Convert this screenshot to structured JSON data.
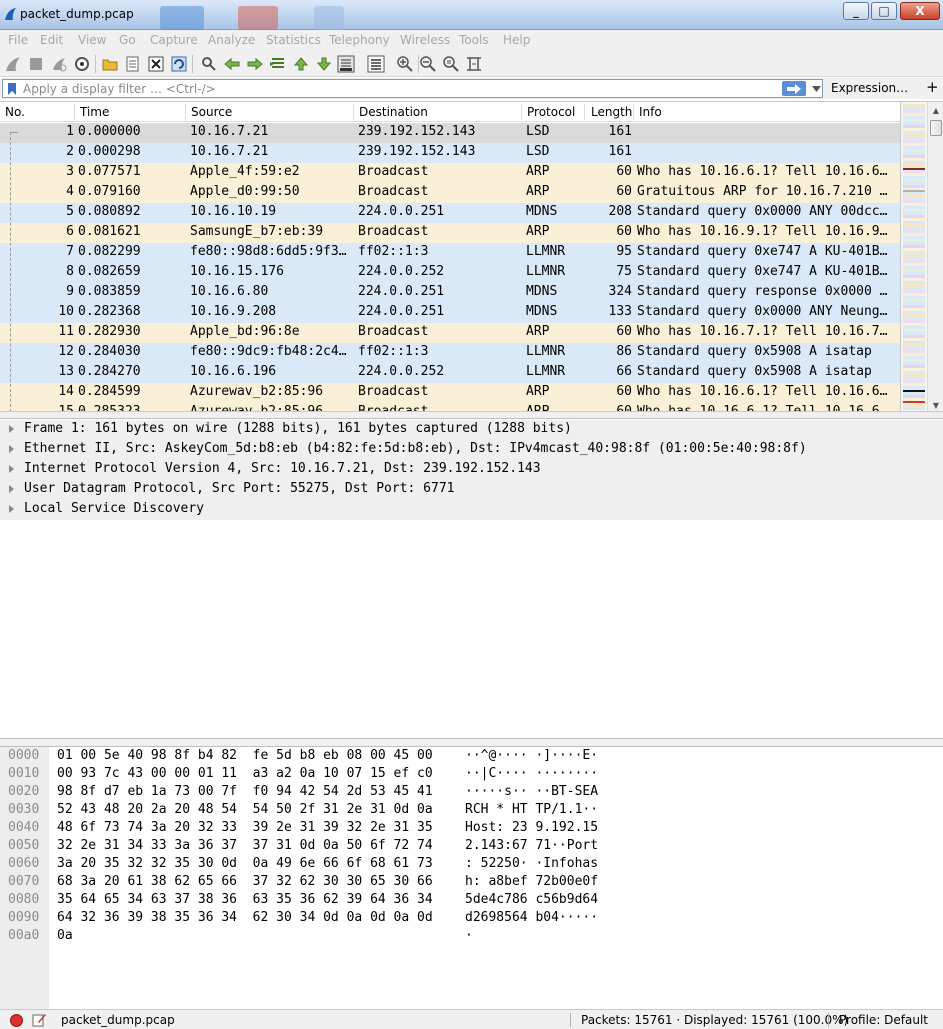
{
  "window": {
    "title": "packet_dump.pcap",
    "minimize": "_",
    "maximize": "□",
    "close": "X"
  },
  "menu": [
    "File",
    "Edit",
    "View",
    "Go",
    "Capture",
    "Analyze",
    "Statistics",
    "Telephony",
    "Wireless",
    "Tools",
    "Help"
  ],
  "toolbar": {
    "icons": [
      "shark-fin-start-icon",
      "stop-capture-icon",
      "restart-capture-icon",
      "capture-options-icon",
      "open-file-icon",
      "file-set-icon",
      "close-file-icon",
      "reload-file-icon",
      "find-packet-icon",
      "go-back-icon",
      "go-forward-icon",
      "go-to-packet-icon",
      "first-packet-icon",
      "last-packet-icon",
      "auto-scroll-icon",
      "colorize-icon",
      "zoom-in-icon",
      "zoom-out-icon",
      "normal-size-icon",
      "resize-columns-icon"
    ]
  },
  "filter": {
    "placeholder": "Apply a display filter … <Ctrl-/>",
    "value": "",
    "expression_label": "Expression…",
    "add_label": "+"
  },
  "packet_list": {
    "columns": [
      "No.",
      "Time",
      "Source",
      "Destination",
      "Protocol",
      "Length",
      "Info"
    ],
    "rows": [
      {
        "no": "1",
        "time": "0.000000",
        "src": "10.16.7.21",
        "dst": "239.192.152.143",
        "proto": "LSD",
        "len": "161",
        "info": "",
        "color": "#dadada"
      },
      {
        "no": "2",
        "time": "0.000298",
        "src": "10.16.7.21",
        "dst": "239.192.152.143",
        "proto": "LSD",
        "len": "161",
        "info": "",
        "color": "#dae9f8"
      },
      {
        "no": "3",
        "time": "0.077571",
        "src": "Apple_4f:59:e2",
        "dst": "Broadcast",
        "proto": "ARP",
        "len": "60",
        "info": "Who has 10.16.6.1? Tell 10.16.6…",
        "color": "#faf0d7"
      },
      {
        "no": "4",
        "time": "0.079160",
        "src": "Apple_d0:99:50",
        "dst": "Broadcast",
        "proto": "ARP",
        "len": "60",
        "info": "Gratuitous ARP for 10.16.7.210 …",
        "color": "#faf0d7"
      },
      {
        "no": "5",
        "time": "0.080892",
        "src": "10.16.10.19",
        "dst": "224.0.0.251",
        "proto": "MDNS",
        "len": "208",
        "info": "Standard query 0x0000 ANY 00dcc…",
        "color": "#dae9f8"
      },
      {
        "no": "6",
        "time": "0.081621",
        "src": "SamsungE_b7:eb:39",
        "dst": "Broadcast",
        "proto": "ARP",
        "len": "60",
        "info": "Who has 10.16.9.1? Tell 10.16.9…",
        "color": "#faf0d7"
      },
      {
        "no": "7",
        "time": "0.082299",
        "src": "fe80::98d8:6dd5:9f3…",
        "dst": "ff02::1:3",
        "proto": "LLMNR",
        "len": "95",
        "info": "Standard query 0xe747 A KU-401B…",
        "color": "#dae9f8"
      },
      {
        "no": "8",
        "time": "0.082659",
        "src": "10.16.15.176",
        "dst": "224.0.0.252",
        "proto": "LLMNR",
        "len": "75",
        "info": "Standard query 0xe747 A KU-401B…",
        "color": "#dae9f8"
      },
      {
        "no": "9",
        "time": "0.083859",
        "src": "10.16.6.80",
        "dst": "224.0.0.251",
        "proto": "MDNS",
        "len": "324",
        "info": "Standard query response 0x0000 …",
        "color": "#dae9f8"
      },
      {
        "no": "10",
        "time": "0.282368",
        "src": "10.16.9.208",
        "dst": "224.0.0.251",
        "proto": "MDNS",
        "len": "133",
        "info": "Standard query 0x0000 ANY Neung…",
        "color": "#dae9f8"
      },
      {
        "no": "11",
        "time": "0.282930",
        "src": "Apple_bd:96:8e",
        "dst": "Broadcast",
        "proto": "ARP",
        "len": "60",
        "info": "Who has 10.16.7.1? Tell 10.16.7…",
        "color": "#faf0d7"
      },
      {
        "no": "12",
        "time": "0.284030",
        "src": "fe80::9dc9:fb48:2c4…",
        "dst": "ff02::1:3",
        "proto": "LLMNR",
        "len": "86",
        "info": "Standard query 0x5908 A isatap",
        "color": "#dae9f8"
      },
      {
        "no": "13",
        "time": "0.284270",
        "src": "10.16.6.196",
        "dst": "224.0.0.252",
        "proto": "LLMNR",
        "len": "66",
        "info": "Standard query 0x5908 A isatap",
        "color": "#dae9f8"
      },
      {
        "no": "14",
        "time": "0.284599",
        "src": "Azurewav_b2:85:96",
        "dst": "Broadcast",
        "proto": "ARP",
        "len": "60",
        "info": "Who has 10.16.6.1? Tell 10.16.6…",
        "color": "#faf0d7"
      },
      {
        "no": "15",
        "time": "0.285323",
        "src": "Azurewav_b2:85:96",
        "dst": "Broadcast",
        "proto": "ARP",
        "len": "60",
        "info": "Who has 10.16.6.1? Tell 10.16.6…",
        "color": "#faf0d7"
      }
    ]
  },
  "details": [
    "Frame 1: 161 bytes on wire (1288 bits), 161 bytes captured (1288 bits)",
    "Ethernet II, Src: AskeyCom_5d:b8:eb (b4:82:fe:5d:b8:eb), Dst: IPv4mcast_40:98:8f (01:00:5e:40:98:8f)",
    "Internet Protocol Version 4, Src: 10.16.7.21, Dst: 239.192.152.143",
    "User Datagram Protocol, Src Port: 55275, Dst Port: 6771",
    "Local Service Discovery"
  ],
  "bytes": [
    {
      "offset": "0000",
      "hex": "01 00 5e 40 98 8f b4 82  fe 5d b8 eb 08 00 45 00",
      "ascii": "··^@···· ·]····E·"
    },
    {
      "offset": "0010",
      "hex": "00 93 7c 43 00 00 01 11  a3 a2 0a 10 07 15 ef c0",
      "ascii": "··|C···· ········"
    },
    {
      "offset": "0020",
      "hex": "98 8f d7 eb 1a 73 00 7f  f0 94 42 54 2d 53 45 41",
      "ascii": "·····s·· ··BT-SEA"
    },
    {
      "offset": "0030",
      "hex": "52 43 48 20 2a 20 48 54  54 50 2f 31 2e 31 0d 0a",
      "ascii": "RCH * HT TP/1.1··"
    },
    {
      "offset": "0040",
      "hex": "48 6f 73 74 3a 20 32 33  39 2e 31 39 32 2e 31 35",
      "ascii": "Host: 23 9.192.15"
    },
    {
      "offset": "0050",
      "hex": "32 2e 31 34 33 3a 36 37  37 31 0d 0a 50 6f 72 74",
      "ascii": "2.143:67 71··Port"
    },
    {
      "offset": "0060",
      "hex": "3a 20 35 32 32 35 30 0d  0a 49 6e 66 6f 68 61 73",
      "ascii": ": 52250· ·Infohas"
    },
    {
      "offset": "0070",
      "hex": "68 3a 20 61 38 62 65 66  37 32 62 30 30 65 30 66",
      "ascii": "h: a8bef 72b00e0f"
    },
    {
      "offset": "0080",
      "hex": "35 64 65 34 63 37 38 36  63 35 36 62 39 64 36 34",
      "ascii": "5de4c786 c56b9d64"
    },
    {
      "offset": "0090",
      "hex": "64 32 36 39 38 35 36 34  62 30 34 0d 0a 0d 0a 0d",
      "ascii": "d2698564 b04·····"
    },
    {
      "offset": "00a0",
      "hex": "0a",
      "ascii": "·"
    }
  ],
  "status": {
    "file": "packet_dump.pcap",
    "packets": "Packets: 15761 · Displayed: 15761 (100.0%)",
    "profile": "Profile: Default"
  }
}
